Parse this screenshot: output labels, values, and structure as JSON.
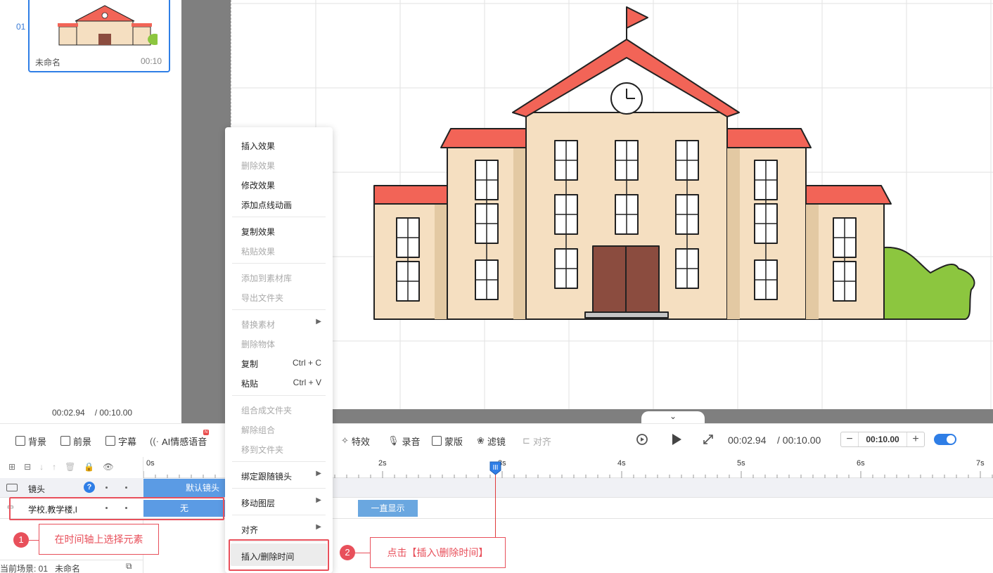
{
  "scene_panel": {
    "index": "01",
    "scene_name": "未命名",
    "scene_duration": "00:10",
    "current_time": "00:02.94",
    "total_time": "/ 00:10.00"
  },
  "toolbar": {
    "background": "背景",
    "foreground": "前景",
    "subtitle": "字幕",
    "ai_voice": "AI情感语音",
    "ai_badge": "N",
    "effects": "特效",
    "record": "录音",
    "mask": "蒙版",
    "filter": "滤镜",
    "align": "对齐",
    "current_time": "00:02.94",
    "total_time": "/ 00:10.00",
    "zoom_value": "00:10.00",
    "zoom_minus": "−",
    "zoom_plus": "+",
    "toggle_on": true
  },
  "timeline": {
    "ticks": [
      "0s",
      "2s",
      "3s",
      "4s",
      "5s",
      "6s",
      "7s"
    ],
    "tracks": [
      {
        "name": "镜头",
        "clip_label": "默认镜头"
      },
      {
        "name": "学校,教学楼,I",
        "clip_label": "无",
        "clip2_label": "一直显示"
      }
    ],
    "help_icon": "?",
    "playhead_time": "2.94s"
  },
  "status_bar": {
    "scene_label": "当前场景: 01",
    "scene_name": "未命名"
  },
  "context_menu": {
    "items": [
      {
        "label": "插入效果",
        "enabled": true
      },
      {
        "label": "删除效果",
        "enabled": false
      },
      {
        "label": "修改效果",
        "enabled": true
      },
      {
        "label": "添加点线动画",
        "enabled": true
      },
      {
        "label": "复制效果",
        "enabled": true
      },
      {
        "label": "粘贴效果",
        "enabled": false
      },
      {
        "label": "添加到素材库",
        "enabled": false
      },
      {
        "label": "导出文件夹",
        "enabled": false
      },
      {
        "label": "替换素材",
        "enabled": false,
        "submenu": true
      },
      {
        "label": "删除物体",
        "enabled": false
      },
      {
        "label": "复制",
        "enabled": true,
        "shortcut": "Ctrl + C"
      },
      {
        "label": "粘贴",
        "enabled": true,
        "shortcut": "Ctrl + V"
      },
      {
        "label": "组合成文件夹",
        "enabled": false
      },
      {
        "label": "解除组合",
        "enabled": false
      },
      {
        "label": "移到文件夹",
        "enabled": false
      },
      {
        "label": "绑定跟随镜头",
        "enabled": true,
        "submenu": true
      },
      {
        "label": "移动图层",
        "enabled": true,
        "submenu": true
      },
      {
        "label": "对齐",
        "enabled": true,
        "submenu": true
      },
      {
        "label": "插入/删除时间",
        "enabled": true
      }
    ]
  },
  "annotations": {
    "step1_num": "1",
    "step1_text": "在时间轴上选择元素",
    "step2_num": "2",
    "step2_text": "点击【插入\\删除时间】"
  },
  "colors": {
    "accent": "#2f7ee6",
    "clip_blue": "#5b9be4",
    "annotation_red": "#e8505b",
    "roof_red": "#f26457",
    "wall_beige": "#f5dfc1",
    "door_brown": "#8b4c3f",
    "bush_green": "#8cc63f"
  }
}
